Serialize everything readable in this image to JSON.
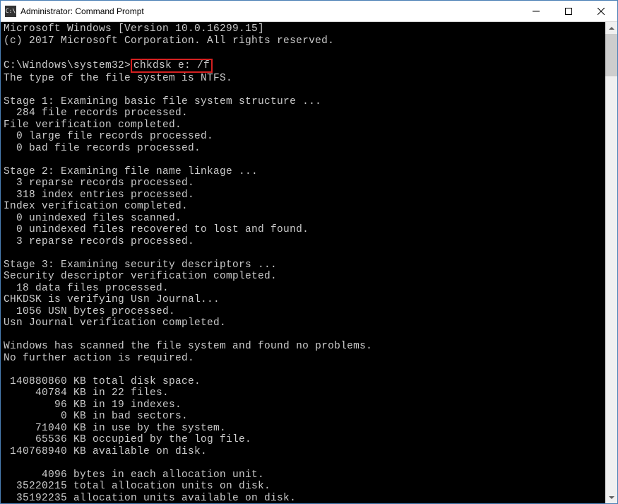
{
  "window": {
    "title": "Administrator: Command Prompt",
    "icon_label": "C:\\"
  },
  "terminal": {
    "header1": "Microsoft Windows [Version 10.0.16299.15]",
    "header2": "(c) 2017 Microsoft Corporation. All rights reserved.",
    "prompt": "C:\\Windows\\system32>",
    "command": "chkdsk e: /f",
    "fs_type": "The type of the file system is NTFS.",
    "stage1_title": "Stage 1: Examining basic file system structure ...",
    "stage1_records": "  284 file records processed.",
    "stage1_fileverif": "File verification completed.",
    "stage1_large": "  0 large file records processed.",
    "stage1_bad": "  0 bad file records processed.",
    "stage2_title": "Stage 2: Examining file name linkage ...",
    "stage2_reparse": "  3 reparse records processed.",
    "stage2_index": "  318 index entries processed.",
    "stage2_indexverif": "Index verification completed.",
    "stage2_unindexed_scan": "  0 unindexed files scanned.",
    "stage2_unindexed_rec": "  0 unindexed files recovered to lost and found.",
    "stage2_reparse2": "  3 reparse records processed.",
    "stage3_title": "Stage 3: Examining security descriptors ...",
    "stage3_secverif": "Security descriptor verification completed.",
    "stage3_datafiles": "  18 data files processed.",
    "stage3_usn": "CHKDSK is verifying Usn Journal...",
    "stage3_usnbytes": "  1056 USN bytes processed.",
    "stage3_usnverif": "Usn Journal verification completed.",
    "result1": "Windows has scanned the file system and found no problems.",
    "result2": "No further action is required.",
    "stat_total": " 140880860 KB total disk space.",
    "stat_files": "     40784 KB in 22 files.",
    "stat_indexes": "        96 KB in 19 indexes.",
    "stat_badsect": "         0 KB in bad sectors.",
    "stat_system": "     71040 KB in use by the system.",
    "stat_logfile": "     65536 KB occupied by the log file.",
    "stat_avail": " 140768940 KB available on disk.",
    "stat_allocunit": "      4096 bytes in each allocation unit.",
    "stat_totalunits": "  35220215 total allocation units on disk.",
    "stat_availunits": "  35192235 allocation units available on disk."
  }
}
